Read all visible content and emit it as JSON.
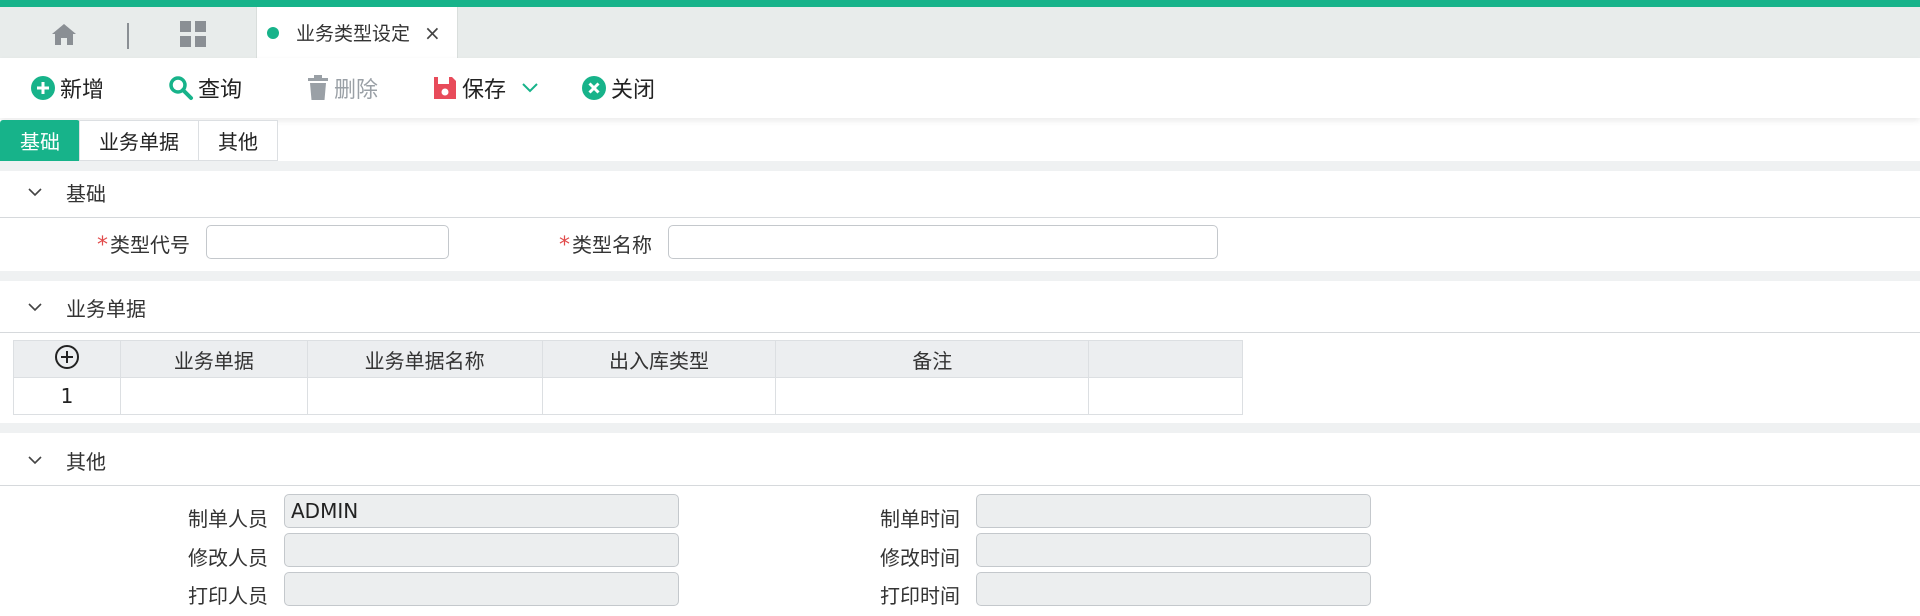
{
  "tabbar": {
    "icons": [
      "home-icon",
      "grid-apps-icon"
    ],
    "tab": {
      "title": "业务类型设定",
      "close_glyph": "×"
    }
  },
  "toolbar": {
    "add_label": "新增",
    "query_label": "查询",
    "delete_label": "删除",
    "save_label": "保存",
    "close_label": "关闭"
  },
  "section_tabs": [
    "基础",
    "业务单据",
    "其他"
  ],
  "basic": {
    "title": "基础",
    "code_label": "类型代号",
    "code_value": "",
    "name_label": "类型名称",
    "name_value": ""
  },
  "documents": {
    "title": "业务单据",
    "columns": [
      "业务单据",
      "业务单据名称",
      "出入库类型",
      "备注"
    ],
    "rows": [
      {
        "index": "1",
        "cells": [
          "",
          "",
          "",
          ""
        ]
      }
    ]
  },
  "other": {
    "title": "其他",
    "creator_label": "制单人员",
    "creator_value": "ADMIN",
    "create_time_label": "制单时间",
    "create_time_value": "",
    "modifier_label": "修改人员",
    "modifier_value": "",
    "modify_time_label": "修改时间",
    "modify_time_value": "",
    "printer_label": "打印人员",
    "printer_value": "",
    "print_time_label": "打印时间",
    "print_time_value": ""
  },
  "colors": {
    "accent": "#17b38a",
    "required": "#e14b4b",
    "save_icon": "#e84b5a"
  }
}
